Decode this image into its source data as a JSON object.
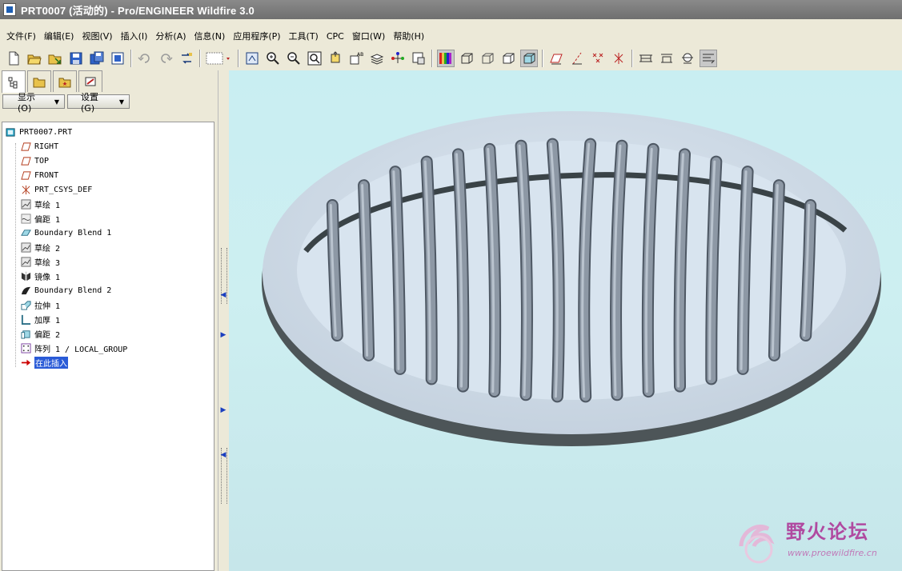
{
  "window": {
    "title": "PRT0007 (活动的) - Pro/ENGINEER Wildfire 3.0"
  },
  "menu": {
    "items": [
      "文件(F)",
      "编辑(E)",
      "视图(V)",
      "插入(I)",
      "分析(A)",
      "信息(N)",
      "应用程序(P)",
      "工具(T)",
      "CPC",
      "窗口(W)",
      "帮助(H)"
    ]
  },
  "toolbar": {
    "icons": [
      "new-icon",
      "open-icon",
      "open-recent-icon",
      "save-icon",
      "save-copy-icon",
      "backup-icon",
      "undo-icon",
      "redo-icon",
      "regenerate-icon",
      "selection-filter-icon",
      "repaint-icon",
      "zoom-in-icon",
      "zoom-out-icon",
      "refit-icon",
      "reorient-icon",
      "saved-views-icon",
      "layers-icon",
      "model-tree-icon",
      "view-manager-icon",
      "shading-colors-icon",
      "wireframe-icon",
      "hidden-line-icon",
      "no-hidden-icon",
      "shading-icon",
      "datum-planes-icon",
      "datum-axes-icon",
      "datum-points-icon",
      "coordinate-systems-icon",
      "measure-icon",
      "section-icon",
      "cross-section-icon",
      "spin-center-icon"
    ]
  },
  "panel": {
    "show_button": "显示 (O)",
    "settings_button": "设置 (G)",
    "tabs": [
      "model-tree-tab-icon",
      "folder-browser-tab-icon",
      "favorites-tab-icon",
      "connections-tab-icon"
    ]
  },
  "tree": {
    "root": "PRT0007.PRT",
    "items": [
      {
        "label": "RIGHT",
        "icon": "datum-plane-icon"
      },
      {
        "label": "TOP",
        "icon": "datum-plane-icon"
      },
      {
        "label": "FRONT",
        "icon": "datum-plane-icon"
      },
      {
        "label": "PRT_CSYS_DEF",
        "icon": "csys-icon"
      },
      {
        "label": "草绘 1",
        "icon": "sketch-icon"
      },
      {
        "label": "偏距 1",
        "icon": "offset-curve-icon"
      },
      {
        "label": "Boundary Blend 1",
        "icon": "boundary-blend-icon"
      },
      {
        "label": "草绘 2",
        "icon": "sketch-icon"
      },
      {
        "label": "草绘 3",
        "icon": "sketch-icon"
      },
      {
        "label": "镜像 1",
        "icon": "mirror-icon"
      },
      {
        "label": "Boundary Blend 2",
        "icon": "boundary-blend-solid-icon"
      },
      {
        "label": "拉伸 1",
        "icon": "extrude-icon"
      },
      {
        "label": "加厚 1",
        "icon": "thicken-icon"
      },
      {
        "label": "偏距 2",
        "icon": "offset-icon"
      },
      {
        "label": "阵列 1 / LOCAL_GROUP",
        "icon": "pattern-icon"
      },
      {
        "label": "在此插入",
        "icon": "insert-here-arrow-icon"
      }
    ]
  },
  "watermark": {
    "title": "野火论坛",
    "url": "www.proewildfire.cn"
  },
  "colors": {
    "viewport_bg": "#c9eef2",
    "model_surface": "#cfdbe8",
    "model_edge": "#4d5558",
    "rib": "#7f8a97",
    "insert_highlight": "#2a5bd7",
    "insert_arrow": "#cc0000"
  }
}
